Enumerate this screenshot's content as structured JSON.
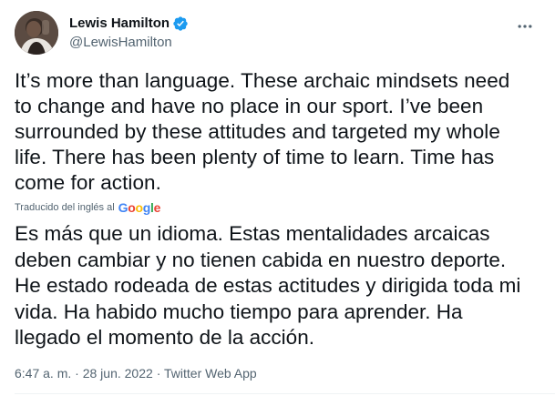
{
  "author": {
    "display_name": "Lewis Hamilton",
    "handle": "@LewisHamilton",
    "verified": true
  },
  "tweet": {
    "text": "It’s more than language. These archaic mindsets need to change and have no place in our sport. I’ve been surrounded by these attitudes and targeted my whole life. There has been plenty of time to learn. Time has come for action.",
    "translated_by_label": "Traducido del inglés al",
    "translated_by_service": "Google",
    "translated_text": "Es más que un idioma. Estas mentalidades arcaicas deben cambiar y no tienen cabida en nuestro deporte. He estado rodeada de estas actitudes y dirigida toda mi vida. Ha habido mucho tiempo para aprender. Ha llegado el momento de la acción.",
    "time": "6:47 a. m.",
    "separator": "·",
    "date": "28 jun. 2022",
    "source": "Twitter Web App"
  },
  "icons": {
    "more": "more-icon",
    "verified": "verified-badge-icon"
  },
  "colors": {
    "text_primary": "#0f1419",
    "text_secondary": "#536471",
    "verified_blue": "#1d9bf0",
    "google_blue": "#4285f4",
    "google_red": "#ea4335",
    "google_yellow": "#fbbc05",
    "google_green": "#34a853"
  }
}
